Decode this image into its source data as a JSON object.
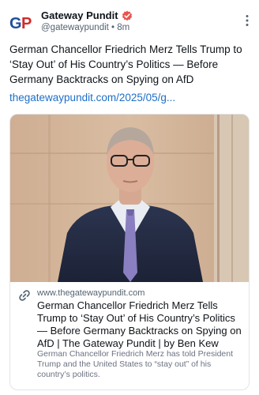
{
  "account": {
    "logo_text": "GP",
    "name": "Gateway Pundit",
    "handle": "@gatewaypundit",
    "separator": "•",
    "time": "8m"
  },
  "post": {
    "text": "German Chancellor Friedrich Merz Tells Trump to ‘Stay Out’ of His Country’s Politics — Before Germany Backtracks on Spying on AfD",
    "link": "thegatewaypundit.com/2025/05/g..."
  },
  "card": {
    "domain": "www.thegatewaypundit.com",
    "title": "German Chancellor Friedrich Merz Tells Trump to ‘Stay Out’ of His Country’s Politics — Before Germany Backtracks on Spying on AfD | The Gateway Pundit | by Ben Kew",
    "description": "German Chancellor Friedrich Merz has told President Trump and the United States to “stay out” of his country’s politics."
  },
  "colors": {
    "verified": "#e8554e",
    "link": "#1d6fc9",
    "logo_blue": "#1e4f9c",
    "logo_red": "#d12a2a"
  }
}
